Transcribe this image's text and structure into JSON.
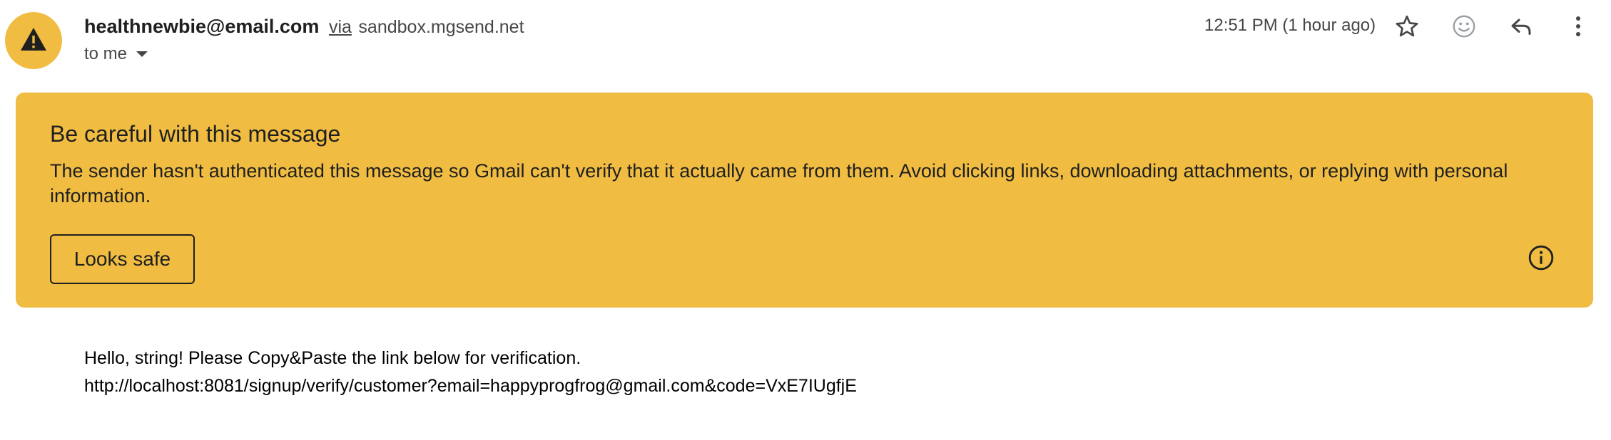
{
  "sender": {
    "email": "healthnewbie@email.com",
    "via_label": "via",
    "via_domain": "sandbox.mgsend.net",
    "to_label": "to me"
  },
  "time": "12:51 PM (1 hour ago)",
  "icons": {
    "avatar": "warning-icon",
    "caret": "chevron-down-icon",
    "star": "star-icon",
    "emoji": "emoji-icon",
    "reply": "reply-icon",
    "more": "more-vert-icon",
    "info": "info-icon"
  },
  "warning": {
    "title": "Be careful with this message",
    "body": "The sender hasn't authenticated this message so Gmail can't verify that it actually came from them. Avoid clicking links, downloading attachments, or replying with personal information.",
    "button_label": "Looks safe",
    "color": "#f0bd42"
  },
  "message": {
    "line1": "Hello, string! Please Copy&Paste the link below for verification.",
    "line2": "http://localhost:8081/signup/verify/customer?email=happyprogfrog@gmail.com&code=VxE7IUgfjE"
  }
}
